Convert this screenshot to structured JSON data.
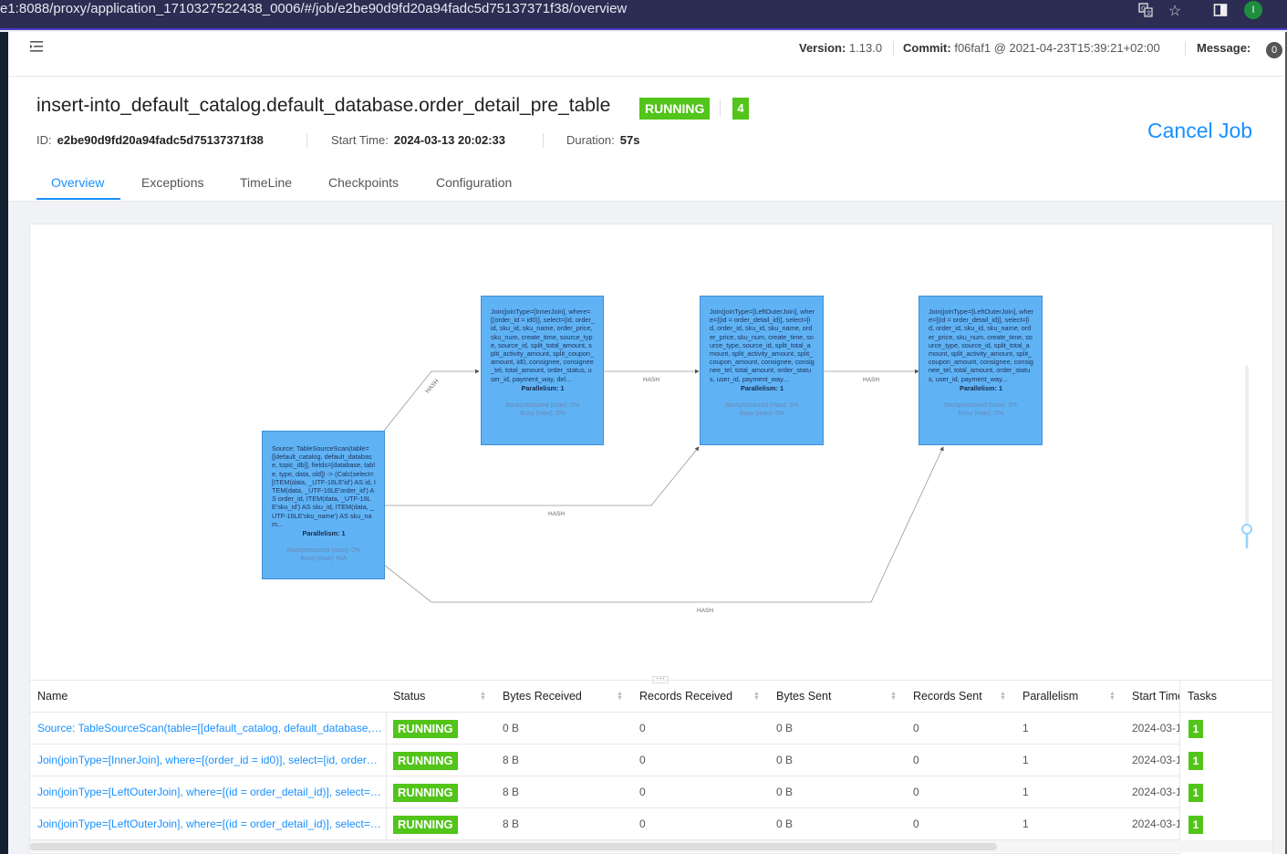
{
  "browser": {
    "url": "e1:8088/proxy/application_1710327522438_0006/#/job/e2be90d9fd20a94fadc5d75137371f38/overview",
    "translate_icon": "translate-icon",
    "star_icon": "star-icon",
    "sidebar_icon": "sidebar-icon",
    "profile_initial": "I"
  },
  "topnav": {
    "version_label": "Version:",
    "version_value": "1.13.0",
    "commit_label": "Commit:",
    "commit_value": "f06faf1 @ 2021-04-23T15:39:21+02:00",
    "message_label": "Message:",
    "message_count": "0"
  },
  "job": {
    "name": "insert-into_default_catalog.default_database.order_detail_pre_table",
    "status": "RUNNING",
    "task_count": "4",
    "id_label": "ID:",
    "id_value": "e2be90d9fd20a94fadc5d75137371f38",
    "start_label": "Start Time:",
    "start_value": "2024-03-13 20:02:33",
    "duration_label": "Duration:",
    "duration_value": "57s",
    "cancel_label": "Cancel Job"
  },
  "tabs": [
    "Overview",
    "Exceptions",
    "TimeLine",
    "Checkpoints",
    "Configuration"
  ],
  "active_tab": "Overview",
  "graph": {
    "nodes": [
      {
        "desc": "Source: TableSourceScan(table=[[default_catalog, default_database, topic_db]], fields=[database, table, type, data, old]) -> (Calc(select=[ITEM(data, _UTF-16LE'id') AS id, ITEM(data, _UTF-16LE'order_id') AS order_id, ITEM(data, _UTF-16LE'sku_id') AS sku_id, ITEM(data, _UTF-16LE'sku_name') AS sku_nam...",
        "parallelism": "Parallelism: 1",
        "backpressured": "Backpressured (max): 0%",
        "busy": "Busy (max): N/A"
      },
      {
        "desc": "Join(joinType=[InnerJoin], where=[(order_id = id0)], select=[id, order_id, sku_id, sku_name, order_price, sku_num, create_time, source_type, source_id, split_total_amount, split_activity_amount, split_coupon_amount, id0, consignee, consignee_tel, total_amount, order_status, user_id, payment_way, del...",
        "parallelism": "Parallelism: 1",
        "backpressured": "Backpressured (max): 0%",
        "busy": "Busy (max): 0%"
      },
      {
        "desc": "Join(joinType=[LeftOuterJoin], where=[(id = order_detail_id)], select=[id, order_id, sku_id, sku_name, order_price, sku_num, create_time, source_type, source_id, split_total_amount, split_activity_amount, split_coupon_amount, consignee, consignee_tel, total_amount, order_status, user_id, payment_way...",
        "parallelism": "Parallelism: 1",
        "backpressured": "Backpressured (max): 0%",
        "busy": "Busy (max): 0%"
      },
      {
        "desc": "Join(joinType=[LeftOuterJoin], where=[(id = order_detail_id)], select=[id, order_id, sku_id, sku_name, order_price, sku_num, create_time, source_type, source_id, split_total_amount, split_activity_amount, split_coupon_amount, consignee, consignee_tel, total_amount, order_status, user_id, payment_way...",
        "parallelism": "Parallelism: 1",
        "backpressured": "Backpressured (max): 0%",
        "busy": "Busy (max): 0%"
      }
    ],
    "edge_label": "HASH"
  },
  "table": {
    "columns": [
      "Name",
      "Status",
      "Bytes Received",
      "Records Received",
      "Bytes Sent",
      "Records Sent",
      "Parallelism",
      "Start Time",
      "Tasks"
    ],
    "rows": [
      {
        "name": "Source: TableSourceScan(table=[[default_catalog, default_database, t...",
        "status": "RUNNING",
        "bytes_received": "0 B",
        "records_received": "0",
        "bytes_sent": "0 B",
        "records_sent": "0",
        "parallelism": "1",
        "start_time": "2024-03-1",
        "tasks": "1"
      },
      {
        "name": "Join(joinType=[InnerJoin], where=[(order_id = id0)], select=[id, order_i...",
        "status": "RUNNING",
        "bytes_received": "8 B",
        "records_received": "0",
        "bytes_sent": "0 B",
        "records_sent": "0",
        "parallelism": "1",
        "start_time": "2024-03-1",
        "tasks": "1"
      },
      {
        "name": "Join(joinType=[LeftOuterJoin], where=[(id = order_detail_id)], select=[...",
        "status": "RUNNING",
        "bytes_received": "8 B",
        "records_received": "0",
        "bytes_sent": "0 B",
        "records_sent": "0",
        "parallelism": "1",
        "start_time": "2024-03-1",
        "tasks": "1"
      },
      {
        "name": "Join(joinType=[LeftOuterJoin], where=[(id = order_detail_id)], select=[...",
        "status": "RUNNING",
        "bytes_received": "8 B",
        "records_received": "0",
        "bytes_sent": "0 B",
        "records_sent": "0",
        "parallelism": "1",
        "start_time": "2024-03-1",
        "tasks": "1"
      }
    ]
  },
  "colors": {
    "accent": "#1890ff",
    "running": "#52c41a",
    "node": "#5fb3f5"
  }
}
